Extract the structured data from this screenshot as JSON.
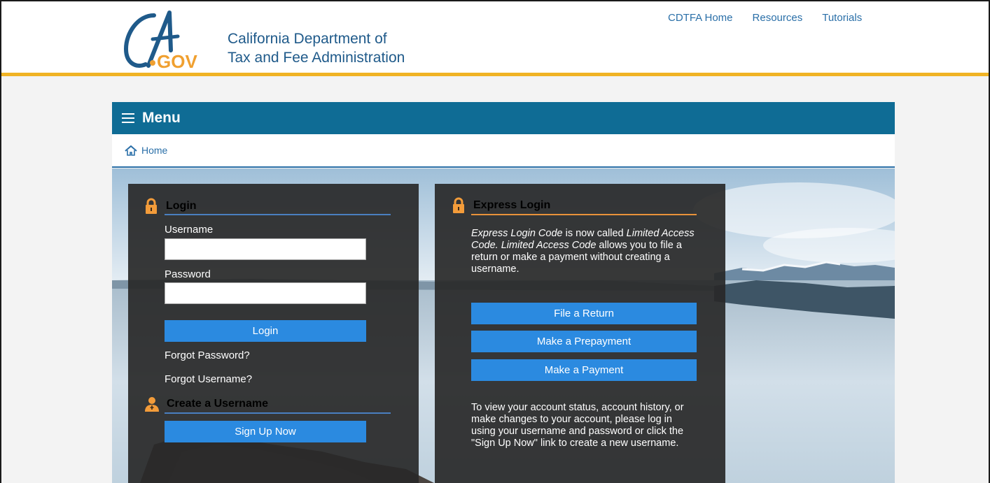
{
  "header": {
    "logo_text": "CA.GOV",
    "org_line1": "California Department of",
    "org_line2": "Tax and Fee Administration",
    "nav": [
      "CDTFA Home",
      "Resources",
      "Tutorials"
    ]
  },
  "menu": {
    "label": "Menu"
  },
  "breadcrumb": {
    "home": "Home"
  },
  "login": {
    "title": "Login",
    "username_label": "Username",
    "username_value": "",
    "password_label": "Password",
    "password_value": "",
    "login_button": "Login",
    "forgot_password": "Forgot Password?",
    "forgot_username": "Forgot Username?"
  },
  "create": {
    "title": "Create a Username",
    "signup_button": "Sign Up Now"
  },
  "express": {
    "title": "Express Login",
    "intro": "Express Login Code is now called Limited Access Code. Limited Access Code allows you to file a return or make a payment without creating a username.",
    "buttons": [
      "File a Return",
      "Make a Prepayment",
      "Make a Payment"
    ],
    "note": "To view your account status, account history, or make changes to your account, please log in using your username and password or click the \"Sign Up Now\" link to create a new username."
  },
  "colors": {
    "brand_blue": "#0f6c95",
    "accent_gold": "#f0b324",
    "button_blue": "#2b8ae0",
    "icon_orange": "#f39c3a"
  }
}
